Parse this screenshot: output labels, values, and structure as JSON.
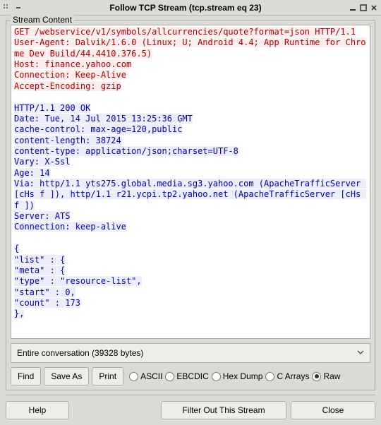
{
  "window": {
    "title": "Follow TCP Stream (tcp.stream eq 23)"
  },
  "fieldset_label": "Stream Content",
  "stream": {
    "request": "GET /webservice/v1/symbols/allcurrencies/quote?format=json HTTP/1.1\nUser-Agent: Dalvik/1.6.0 (Linux; U; Android 4.4; App Runtime for Chrome Dev Build/44.4410.376.5)\nHost: finance.yahoo.com\nConnection: Keep-Alive\nAccept-Encoding: gzip\n",
    "response": "HTTP/1.1 200 OK\nDate: Tue, 14 Jul 2015 13:25:36 GMT\ncache-control: max-age=120,public\ncontent-length: 38724\ncontent-type: application/json;charset=UTF-8\nVary: X-Ssl\nAge: 14\nVia: http/1.1 yts275.global.media.sg3.yahoo.com (ApacheTrafficServer [cHs f ]), http/1.1 r21.ycpi.tp2.yahoo.net (ApacheTrafficServer [cHs f ])\nServer: ATS\nConnection: keep-alive\n\n{\n\"list\" : {\n\"meta\" : {\n\"type\" : \"resource-list\",\n\"start\" : 0,\n\"count\" : 173\n},"
  },
  "dropdown": {
    "selected": "Entire conversation (39328 bytes)"
  },
  "buttons": {
    "find": "Find",
    "save_as": "Save As",
    "print": "Print",
    "help": "Help",
    "filter_out": "Filter Out This Stream",
    "close": "Close"
  },
  "radios": {
    "ascii": "ASCII",
    "ebcdic": "EBCDIC",
    "hexdump": "Hex Dump",
    "carrays": "C Arrays",
    "raw": "Raw"
  }
}
